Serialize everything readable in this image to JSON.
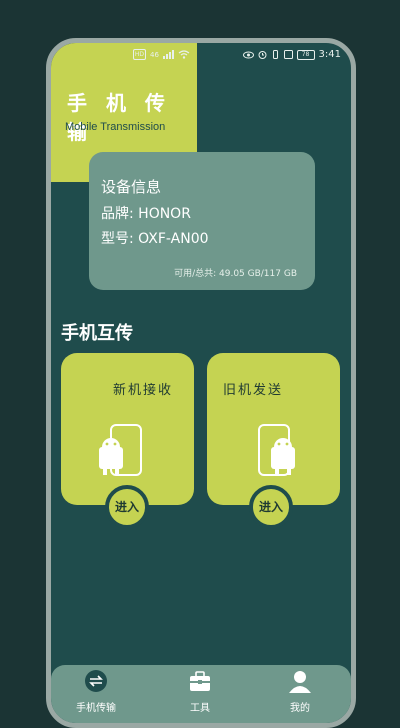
{
  "status": {
    "left_icons": [
      "HD",
      "46",
      "signal-icon",
      "wifi-icon"
    ],
    "right_icons": [
      "eye-icon",
      "alarm-icon",
      "vibrate-icon",
      "nfc-icon"
    ],
    "battery": "78",
    "time": "3:41"
  },
  "header": {
    "title": "手 机 传 输",
    "subtitle": "Mobile Transmission"
  },
  "device_info": {
    "title": "设备信息",
    "brand": "品牌:  HONOR",
    "model": "型号:  OXF-AN00",
    "storage": "可用/总共:  49.05 GB/117 GB"
  },
  "section": {
    "title": "手机互传"
  },
  "cards": [
    {
      "label": "新机接收",
      "button": "进入"
    },
    {
      "label": "旧机发送",
      "button": "进入"
    }
  ],
  "nav": [
    {
      "label": "手机传输",
      "icon": "transfer-icon"
    },
    {
      "label": "工具",
      "icon": "toolbox-icon"
    },
    {
      "label": "我的",
      "icon": "user-icon"
    }
  ],
  "colors": {
    "background": "#1f4c4c",
    "accent": "#c5d352",
    "card": "#6f988c"
  }
}
